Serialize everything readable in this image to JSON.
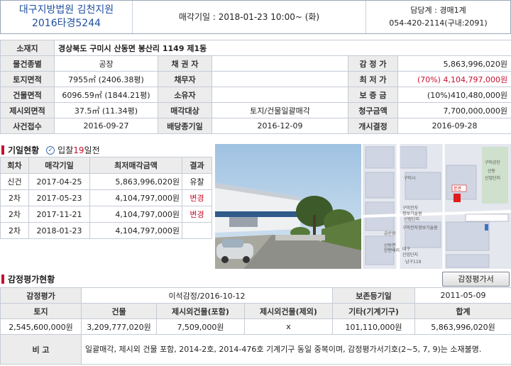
{
  "header": {
    "court_name": "대구지방법원 김천지원",
    "case_no": "2016타경5244",
    "sale_date_text": "매각기일 : 2018-01-23   10:00~ (화)",
    "staff_dept": "담당계 : 경매1계",
    "staff_phone": "054-420-2114(구내:2091)"
  },
  "info": {
    "location_label": "소재지",
    "location": "경상북도 구미시 산동면 봉산리 1149 제1동",
    "rows": [
      [
        "물건종별",
        "공장",
        "채 권 자",
        "",
        "감 정 가",
        "5,863,996,020원"
      ],
      [
        "토지면적",
        "7955㎡ (2406.38평)",
        "채무자",
        "",
        "최 저 가",
        "(70%) 4,104,797,000원"
      ],
      [
        "건물면적",
        "6096.59㎡ (1844.21평)",
        "소유자",
        "",
        "보 증 금",
        "(10%)410,480,000원"
      ],
      [
        "제시외면적",
        "37.5㎡ (11.34평)",
        "매각대상",
        "토지/건물일괄매각",
        "청구금액",
        "7,700,000,000원"
      ],
      [
        "사건접수",
        "2016-09-27",
        "배당종기일",
        "2016-12-09",
        "개시결정",
        "2016-09-28"
      ]
    ]
  },
  "history": {
    "title": "기일현황",
    "badge_prefix": "입찰",
    "badge_days": "19",
    "badge_suffix": "일전",
    "headers": [
      "회차",
      "매각기일",
      "최저매각금액",
      "결과"
    ],
    "rows": [
      [
        "신건",
        "2017-04-25",
        "5,863,996,020원",
        "유찰"
      ],
      [
        "2차",
        "2017-05-23",
        "4,104,797,000원",
        "변경"
      ],
      [
        "2차",
        "2017-11-21",
        "4,104,797,000원",
        "변경"
      ],
      [
        "2차",
        "2018-01-23",
        "4,104,797,000원",
        ""
      ]
    ]
  },
  "map": {
    "marker_label": "본관",
    "labels": [
      "구미시",
      "구미전자",
      "정보기술원",
      "산림단지",
      "구미전자정보기술원",
      "금산원",
      "산동면",
      "대구",
      "산업단지",
      "한편배리",
      "남구119",
      "구미공단",
      "산동",
      "산업단지"
    ]
  },
  "appraisal": {
    "title": "감정평가현황",
    "button": "감정평가서",
    "row1": [
      "감정평가",
      "이석감정/2016-10-12",
      "보존등기일",
      "2011-05-09"
    ],
    "headers": [
      "토지",
      "건물",
      "제시외건물(포함)",
      "제시외건물(제외)",
      "기타(기계기구)",
      "합계"
    ],
    "values": [
      "2,545,600,000원",
      "3,209,777,020원",
      "7,509,000원",
      "x",
      "101,110,000원",
      "5,863,996,020원"
    ],
    "note_label": "비 고",
    "note": "일괄매각, 제시외 건물 포함, 2014-2호, 2014-476호 기계기구 동일 중복이며, 감정평가서기호(2~5, 7, 9)는 소재불명."
  }
}
